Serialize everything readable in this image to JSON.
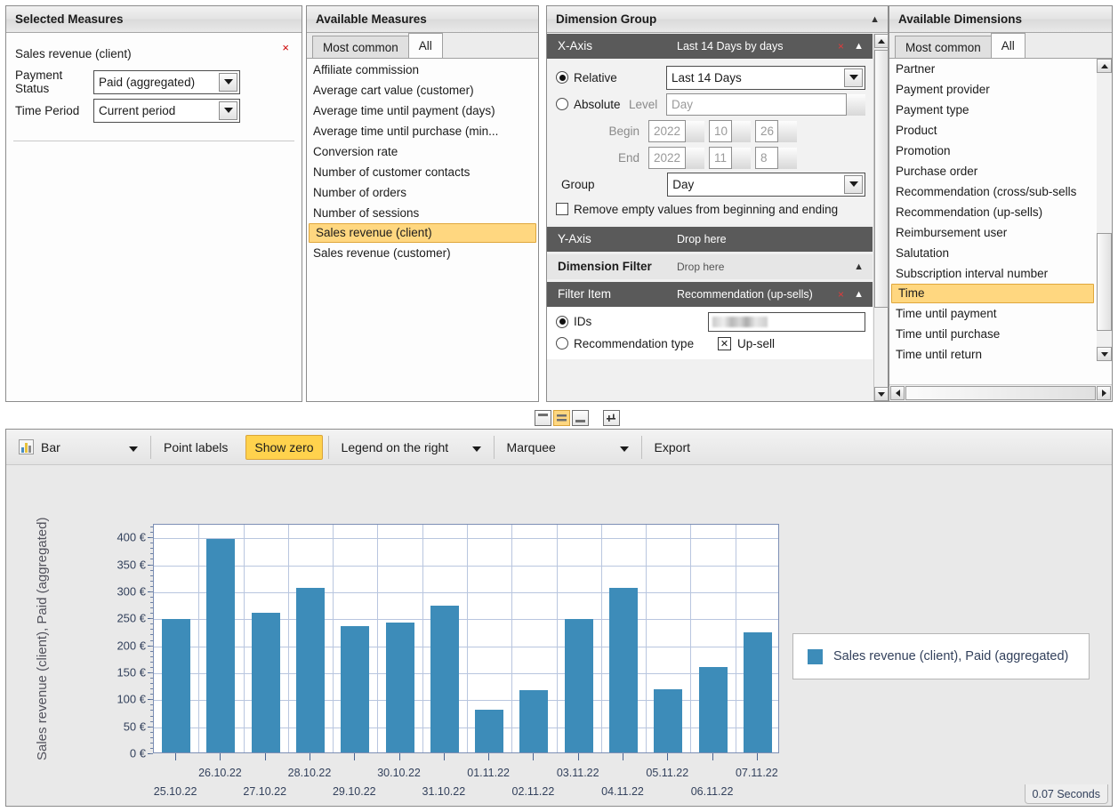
{
  "selected_measures": {
    "title": "Selected Measures",
    "measure_name": "Sales revenue (client)",
    "remove_icon": "×",
    "fields": [
      {
        "label": "Payment Status",
        "value": "Paid (aggregated)"
      },
      {
        "label": "Time Period",
        "value": "Current period"
      }
    ]
  },
  "available_measures": {
    "title": "Available Measures",
    "tabs": [
      {
        "label": "Most common",
        "active": false
      },
      {
        "label": "All",
        "active": true
      }
    ],
    "items": [
      "Affiliate commission",
      "Average cart value (customer)",
      "Average time until payment (days)",
      "Average time until purchase (min...",
      "Conversion rate",
      "Number of customer contacts",
      "Number of orders",
      "Number of sessions",
      "Sales revenue (client)",
      "Sales revenue (customer)"
    ],
    "selected_item": "Sales revenue (client)"
  },
  "dimension_group": {
    "title": "Dimension Group",
    "x_axis": {
      "label": "X-Axis",
      "value": "Last 14 Days by days",
      "remove_icon": "×",
      "relative_label": "Relative",
      "relative_selected": true,
      "relative_value": "Last 14 Days",
      "absolute_label": "Absolute",
      "absolute_selected": false,
      "level_label": "Level",
      "level_value": "Day",
      "begin_label": "Begin",
      "begin_year": "2022",
      "begin_month": "10",
      "begin_day": "26",
      "end_label": "End",
      "end_year": "2022",
      "end_month": "11",
      "end_day": "8",
      "group_label": "Group",
      "group_value": "Day",
      "remove_empty_label": "Remove empty values from beginning and ending",
      "remove_empty_checked": false
    },
    "y_axis": {
      "label": "Y-Axis",
      "value": "Drop here"
    },
    "dimension_filter": {
      "label": "Dimension Filter",
      "value": "Drop here"
    },
    "filter_item": {
      "label": "Filter Item",
      "value": "Recommendation (up-sells)",
      "remove_icon": "×",
      "ids_label": "IDs",
      "ids_selected": true,
      "ids_value": "",
      "type_label": "Recommendation type",
      "type_selected": false,
      "type_chip_mark": "✕",
      "type_chip_label": "Up-sell"
    }
  },
  "available_dimensions": {
    "title": "Available Dimensions",
    "tabs": [
      {
        "label": "Most common",
        "active": false
      },
      {
        "label": "All",
        "active": true
      }
    ],
    "items": [
      "Partner",
      "Payment provider",
      "Payment type",
      "Product",
      "Promotion",
      "Purchase order",
      "Recommendation (cross/sub-sells",
      "Recommendation (up-sells)",
      "Reimbursement user",
      "Salutation",
      "Subscription interval number",
      "Time",
      "Time until payment",
      "Time until purchase",
      "Time until return"
    ],
    "selected_item": "Time"
  },
  "layout_toolbar": {
    "buttons": [
      {
        "name": "layout-top",
        "active": false
      },
      {
        "name": "layout-split",
        "active": true
      },
      {
        "name": "layout-bottom",
        "active": false
      },
      {
        "name": "layout-settings",
        "active": false
      }
    ]
  },
  "chart_toolbar": {
    "chart_type": "Bar",
    "chart_type_icon": "bar-chart-icon",
    "point_labels": "Point labels",
    "show_zero": "Show zero",
    "show_zero_active": true,
    "legend_position": "Legend on the right",
    "selection_mode": "Marquee",
    "export": "Export"
  },
  "status": {
    "duration": "0.07 Seconds"
  },
  "colors": {
    "bar": "#3d8cb9",
    "highlight": "#ffd780",
    "accent_yellow": "#ffd24d",
    "axis_text": "#33415c",
    "grid": "#b9c6df"
  },
  "chart_data": {
    "type": "bar",
    "title": "",
    "xlabel": "",
    "ylabel": "Sales revenue (client), Paid (aggregated)",
    "ylim": [
      0,
      425
    ],
    "yticks": [
      0,
      50,
      100,
      150,
      200,
      250,
      300,
      350,
      400
    ],
    "ytick_labels": [
      "0 €",
      "50 €",
      "100 €",
      "150 €",
      "200 €",
      "250 €",
      "300 €",
      "350 €",
      "400 €"
    ],
    "grid": true,
    "legend_position": "right",
    "categories": [
      "25.10.22",
      "26.10.22",
      "27.10.22",
      "28.10.22",
      "29.10.22",
      "30.10.22",
      "31.10.22",
      "01.11.22",
      "02.11.22",
      "03.11.22",
      "04.11.22",
      "05.11.22",
      "06.11.22",
      "07.11.22"
    ],
    "series": [
      {
        "name": "Sales revenue (client), Paid (aggregated)",
        "color": "#3d8cb9",
        "values": [
          247,
          396,
          259,
          304,
          234,
          240,
          272,
          79,
          116,
          247,
          304,
          117,
          158,
          222
        ]
      }
    ]
  }
}
